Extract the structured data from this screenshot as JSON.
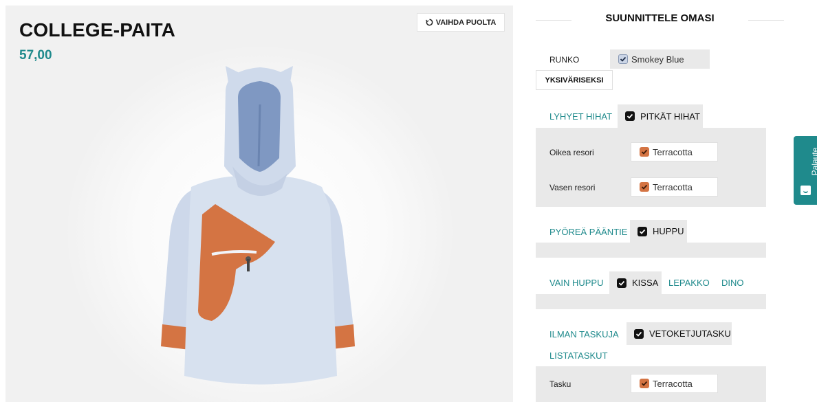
{
  "product": {
    "title": "COLLEGE-PAITA",
    "price": "57,00",
    "flip_label": "VAIHDA PUOLTA"
  },
  "config": {
    "heading": "SUUNNITTELE OMASI",
    "body": {
      "label": "RUNKO",
      "value": "Smokey Blue"
    },
    "monochrome_label": "YKSIVÄRISEKSI",
    "sleeves": {
      "short_label": "LYHYET HIHAT",
      "long_label": "PITKÄT HIHAT",
      "right_cuff": {
        "label": "Oikea resori",
        "value": "Terracotta"
      },
      "left_cuff": {
        "label": "Vasen resori",
        "value": "Terracotta"
      }
    },
    "neck": {
      "round_label": "PYÖREÄ PÄÄNTIE",
      "hood_label": "HUPPU"
    },
    "hood_type": {
      "plain_label": "VAIN HUPPU",
      "cat_label": "KISSA",
      "bat_label": "LEPAKKO",
      "dino_label": "DINO"
    },
    "pockets": {
      "none_label": "ILMAN TASKUJA",
      "zip_label": "VETOKETJUTASKU",
      "strip_label": "LISTATASKUT",
      "pocket": {
        "label": "Tasku",
        "value": "Terracotta"
      }
    }
  },
  "feedback_label": "Palaute",
  "colors": {
    "accent": "#1f8a8c",
    "terracotta": "#d47443",
    "smokey_blue": "#cbd5e6",
    "chip_bg": "#e9e9e9"
  },
  "icons": [
    "rotate-icon",
    "check-icon",
    "feedback-icon"
  ]
}
